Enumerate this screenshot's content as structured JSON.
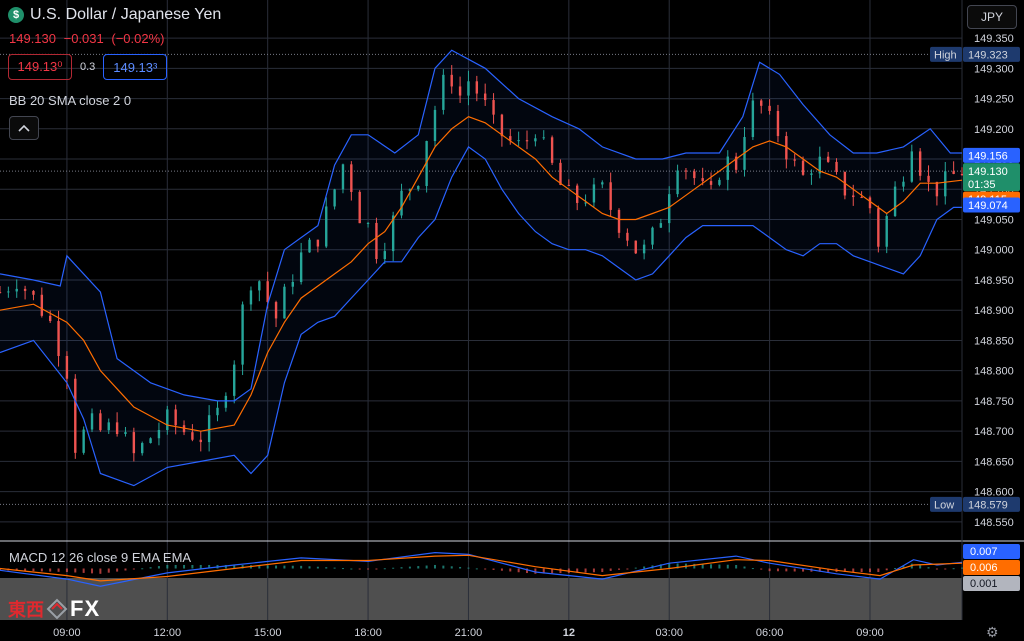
{
  "header": {
    "symbol_icon": "$",
    "symbol_title": "U.S. Dollar / Japanese Yen",
    "last_price": "149.130",
    "change": "−0.031",
    "change_pct": "(−0.02%)",
    "sell_quote": "149.13⁰",
    "buy_quote": "149.13³",
    "spread": "0.3",
    "indicator_label": "BB 20 SMA close 2 0",
    "collapse_icon": "chevron-up-icon",
    "currency": "JPY"
  },
  "macd_label": "MACD 12 26 close 9 EMA EMA",
  "logo": {
    "cn": "東西",
    "fx": "FX"
  },
  "colors": {
    "up": "#26a69a",
    "down": "#ef5350",
    "bb": "#2962ff",
    "basis": "#ff6d00",
    "macd": "#2962ff",
    "signal": "#ff6d00",
    "grid": "#2a2e39",
    "high_low_tag": "#1e3a6e",
    "last_price_tag": "#1f8f6a"
  },
  "chart_data": [
    {
      "type": "candlestick",
      "title": "U.S. Dollar / Japanese Yen",
      "ylim": [
        148.52,
        149.37
      ],
      "yticks": [
        "149.350",
        "149.300",
        "149.250",
        "149.200",
        "149.150",
        "149.100",
        "149.050",
        "149.000",
        "148.950",
        "148.900",
        "148.850",
        "148.800",
        "148.750",
        "148.700",
        "148.650",
        "148.600",
        "148.550"
      ],
      "xticks": [
        "09:00",
        "12:00",
        "15:00",
        "18:00",
        "21:00",
        "12",
        "03:00",
        "06:00",
        "09:00"
      ],
      "x_range_hours": [
        -2.0,
        26.75
      ],
      "markers": {
        "high": {
          "label": "High",
          "value": "149.323"
        },
        "low": {
          "label": "Low",
          "value": "148.579"
        }
      },
      "price_tags": {
        "upper": "149.156",
        "last": "149.130",
        "countdown": "01:35",
        "basis": "149.115",
        "lower": "149.074"
      },
      "close_path": [
        [
          -2.0,
          148.93
        ],
        [
          -1.5,
          148.95
        ],
        [
          -1.0,
          148.92
        ],
        [
          -0.5,
          148.88
        ],
        [
          0.0,
          148.8
        ],
        [
          0.3,
          148.65
        ],
        [
          0.6,
          148.72
        ],
        [
          1.0,
          148.7
        ],
        [
          1.5,
          148.71
        ],
        [
          2.0,
          148.66
        ],
        [
          2.5,
          148.69
        ],
        [
          3.0,
          148.72
        ],
        [
          3.5,
          148.7
        ],
        [
          4.0,
          148.69
        ],
        [
          4.5,
          148.73
        ],
        [
          5.0,
          148.82
        ],
        [
          5.4,
          148.95
        ],
        [
          5.8,
          148.95
        ],
        [
          6.2,
          148.88
        ],
        [
          6.6,
          148.94
        ],
        [
          7.0,
          148.99
        ],
        [
          7.5,
          149.02
        ],
        [
          8.0,
          149.1
        ],
        [
          8.3,
          149.15
        ],
        [
          8.7,
          149.06
        ],
        [
          9.0,
          149.04
        ],
        [
          9.3,
          148.99
        ],
        [
          9.7,
          149.04
        ],
        [
          10.0,
          149.09
        ],
        [
          10.5,
          149.12
        ],
        [
          10.8,
          149.2
        ],
        [
          11.1,
          149.25
        ],
        [
          11.4,
          149.3
        ],
        [
          11.7,
          149.25
        ],
        [
          12.0,
          149.28
        ],
        [
          12.4,
          149.25
        ],
        [
          12.8,
          149.2
        ],
        [
          13.2,
          149.18
        ],
        [
          13.6,
          149.17
        ],
        [
          14.0,
          149.2
        ],
        [
          14.4,
          149.15
        ],
        [
          14.8,
          149.1
        ],
        [
          15.2,
          149.08
        ],
        [
          15.6,
          149.09
        ],
        [
          16.0,
          149.1
        ],
        [
          16.4,
          149.05
        ],
        [
          16.8,
          149.02
        ],
        [
          17.1,
          148.99
        ],
        [
          17.4,
          149.01
        ],
        [
          17.8,
          149.06
        ],
        [
          18.2,
          149.15
        ],
        [
          18.6,
          149.13
        ],
        [
          19.0,
          149.1
        ],
        [
          19.3,
          149.09
        ],
        [
          19.6,
          149.15
        ],
        [
          20.0,
          149.14
        ],
        [
          20.3,
          149.21
        ],
        [
          20.6,
          149.25
        ],
        [
          20.9,
          149.22
        ],
        [
          21.2,
          149.2
        ],
        [
          21.6,
          149.15
        ],
        [
          22.0,
          149.12
        ],
        [
          22.4,
          149.15
        ],
        [
          22.8,
          149.13
        ],
        [
          23.2,
          149.1
        ],
        [
          23.6,
          149.09
        ],
        [
          24.0,
          149.07
        ],
        [
          24.3,
          149.0
        ],
        [
          24.6,
          149.08
        ],
        [
          25.0,
          149.13
        ],
        [
          25.3,
          149.19
        ],
        [
          25.6,
          149.11
        ],
        [
          26.0,
          149.1
        ],
        [
          26.4,
          149.12
        ],
        [
          26.75,
          149.13
        ]
      ],
      "bollinger": {
        "period": 20,
        "stdev": 2,
        "upper": [
          [
            -2.0,
            148.96
          ],
          [
            -1.0,
            148.95
          ],
          [
            -0.2,
            148.94
          ],
          [
            0.0,
            148.99
          ],
          [
            1.0,
            148.93
          ],
          [
            1.5,
            148.82
          ],
          [
            2.5,
            148.78
          ],
          [
            3.5,
            148.76
          ],
          [
            4.5,
            148.75
          ],
          [
            5.0,
            148.75
          ],
          [
            5.5,
            148.77
          ],
          [
            6.0,
            148.91
          ],
          [
            6.5,
            149.0
          ],
          [
            7.0,
            149.02
          ],
          [
            7.5,
            149.04
          ],
          [
            8.0,
            149.14
          ],
          [
            8.5,
            149.19
          ],
          [
            9.0,
            149.19
          ],
          [
            9.8,
            149.16
          ],
          [
            10.5,
            149.19
          ],
          [
            11.0,
            149.3
          ],
          [
            11.5,
            149.33
          ],
          [
            12.5,
            149.3
          ],
          [
            13.5,
            149.25
          ],
          [
            14.5,
            149.22
          ],
          [
            15.3,
            149.2
          ],
          [
            16.0,
            149.17
          ],
          [
            17.0,
            149.15
          ],
          [
            17.8,
            149.15
          ],
          [
            18.5,
            149.16
          ],
          [
            19.5,
            149.16
          ],
          [
            20.2,
            149.22
          ],
          [
            20.7,
            149.31
          ],
          [
            21.3,
            149.29
          ],
          [
            22.0,
            149.24
          ],
          [
            22.8,
            149.19
          ],
          [
            23.5,
            149.16
          ],
          [
            24.2,
            149.16
          ],
          [
            25.0,
            149.17
          ],
          [
            25.8,
            149.2
          ],
          [
            26.4,
            149.16
          ],
          [
            26.75,
            149.16
          ]
        ],
        "basis": [
          [
            -2.0,
            148.9
          ],
          [
            -1.0,
            148.91
          ],
          [
            0.0,
            148.88
          ],
          [
            0.5,
            148.85
          ],
          [
            1.0,
            148.8
          ],
          [
            2.0,
            148.74
          ],
          [
            3.0,
            148.71
          ],
          [
            4.0,
            148.7
          ],
          [
            5.0,
            148.71
          ],
          [
            5.5,
            148.76
          ],
          [
            6.0,
            148.83
          ],
          [
            6.5,
            148.88
          ],
          [
            7.0,
            148.92
          ],
          [
            7.5,
            148.94
          ],
          [
            8.0,
            148.96
          ],
          [
            8.5,
            148.98
          ],
          [
            9.0,
            149.01
          ],
          [
            9.5,
            149.03
          ],
          [
            10.0,
            149.07
          ],
          [
            10.5,
            149.12
          ],
          [
            11.0,
            149.17
          ],
          [
            11.5,
            149.2
          ],
          [
            12.0,
            149.22
          ],
          [
            12.5,
            149.21
          ],
          [
            13.0,
            149.19
          ],
          [
            13.5,
            149.17
          ],
          [
            14.0,
            149.15
          ],
          [
            14.5,
            149.12
          ],
          [
            15.0,
            149.1
          ],
          [
            15.5,
            149.08
          ],
          [
            16.0,
            149.06
          ],
          [
            16.5,
            149.05
          ],
          [
            17.0,
            149.05
          ],
          [
            17.5,
            149.06
          ],
          [
            18.0,
            149.07
          ],
          [
            18.5,
            149.09
          ],
          [
            19.0,
            149.11
          ],
          [
            19.5,
            149.13
          ],
          [
            20.0,
            149.15
          ],
          [
            20.5,
            149.17
          ],
          [
            21.0,
            149.18
          ],
          [
            21.5,
            149.17
          ],
          [
            22.0,
            149.15
          ],
          [
            22.5,
            149.13
          ],
          [
            23.0,
            149.12
          ],
          [
            23.5,
            149.1
          ],
          [
            24.0,
            149.08
          ],
          [
            24.5,
            149.06
          ],
          [
            25.0,
            149.08
          ],
          [
            25.5,
            149.11
          ],
          [
            26.0,
            149.11
          ],
          [
            26.75,
            149.115
          ]
        ],
        "lower": [
          [
            -2.0,
            148.83
          ],
          [
            -1.0,
            148.85
          ],
          [
            0.0,
            148.78
          ],
          [
            0.5,
            148.72
          ],
          [
            1.0,
            148.63
          ],
          [
            2.0,
            148.61
          ],
          [
            3.0,
            148.64
          ],
          [
            4.0,
            148.65
          ],
          [
            5.0,
            148.66
          ],
          [
            5.5,
            148.63
          ],
          [
            6.0,
            148.66
          ],
          [
            6.5,
            148.78
          ],
          [
            7.0,
            148.86
          ],
          [
            7.5,
            148.88
          ],
          [
            8.0,
            148.89
          ],
          [
            8.5,
            148.92
          ],
          [
            9.0,
            148.95
          ],
          [
            9.5,
            148.98
          ],
          [
            10.0,
            148.98
          ],
          [
            10.5,
            149.02
          ],
          [
            11.0,
            149.05
          ],
          [
            11.5,
            149.12
          ],
          [
            12.0,
            149.17
          ],
          [
            12.5,
            149.15
          ],
          [
            13.0,
            149.1
          ],
          [
            13.5,
            149.06
          ],
          [
            14.0,
            149.03
          ],
          [
            14.5,
            149.01
          ],
          [
            15.0,
            149.0
          ],
          [
            15.5,
            149.0
          ],
          [
            16.0,
            148.99
          ],
          [
            16.5,
            148.97
          ],
          [
            17.0,
            148.95
          ],
          [
            17.5,
            148.96
          ],
          [
            18.0,
            148.99
          ],
          [
            18.5,
            149.02
          ],
          [
            19.0,
            149.04
          ],
          [
            19.5,
            149.04
          ],
          [
            20.0,
            149.04
          ],
          [
            20.5,
            149.04
          ],
          [
            21.0,
            149.02
          ],
          [
            21.5,
            149.0
          ],
          [
            22.0,
            148.99
          ],
          [
            22.5,
            149.01
          ],
          [
            23.0,
            149.01
          ],
          [
            23.5,
            148.99
          ],
          [
            24.0,
            148.98
          ],
          [
            24.5,
            148.97
          ],
          [
            25.0,
            148.96
          ],
          [
            25.5,
            148.99
          ],
          [
            26.0,
            149.05
          ],
          [
            26.5,
            149.07
          ],
          [
            26.75,
            149.07
          ]
        ]
      }
    },
    {
      "type": "macd",
      "title": "MACD 12 26 close 9 EMA EMA",
      "ylim": [
        -0.03,
        0.03
      ],
      "values": {
        "macd": "0.007",
        "signal": "0.006",
        "histogram": "0.001"
      },
      "macd_path": [
        [
          -2.0,
          -0.002
        ],
        [
          0.0,
          -0.012
        ],
        [
          1.0,
          -0.02
        ],
        [
          3.0,
          -0.005
        ],
        [
          5.0,
          0.004
        ],
        [
          7.0,
          0.012
        ],
        [
          9.0,
          0.008
        ],
        [
          11.0,
          0.018
        ],
        [
          12.0,
          0.016
        ],
        [
          14.0,
          -0.004
        ],
        [
          16.0,
          -0.012
        ],
        [
          18.0,
          0.006
        ],
        [
          20.0,
          0.014
        ],
        [
          21.0,
          0.006
        ],
        [
          23.0,
          -0.006
        ],
        [
          24.3,
          -0.012
        ],
        [
          25.3,
          0.01
        ],
        [
          26.0,
          0.004
        ],
        [
          26.75,
          0.007
        ]
      ],
      "signal_path": [
        [
          -2.0,
          0.0
        ],
        [
          0.0,
          -0.008
        ],
        [
          1.0,
          -0.014
        ],
        [
          3.0,
          -0.009
        ],
        [
          5.0,
          0.0
        ],
        [
          7.0,
          0.009
        ],
        [
          9.0,
          0.009
        ],
        [
          11.0,
          0.014
        ],
        [
          12.0,
          0.015
        ],
        [
          14.0,
          0.002
        ],
        [
          16.0,
          -0.008
        ],
        [
          18.0,
          0.0
        ],
        [
          20.0,
          0.01
        ],
        [
          21.0,
          0.009
        ],
        [
          23.0,
          -0.002
        ],
        [
          24.3,
          -0.008
        ],
        [
          25.3,
          0.004
        ],
        [
          26.0,
          0.005
        ],
        [
          26.75,
          0.006
        ]
      ]
    }
  ]
}
